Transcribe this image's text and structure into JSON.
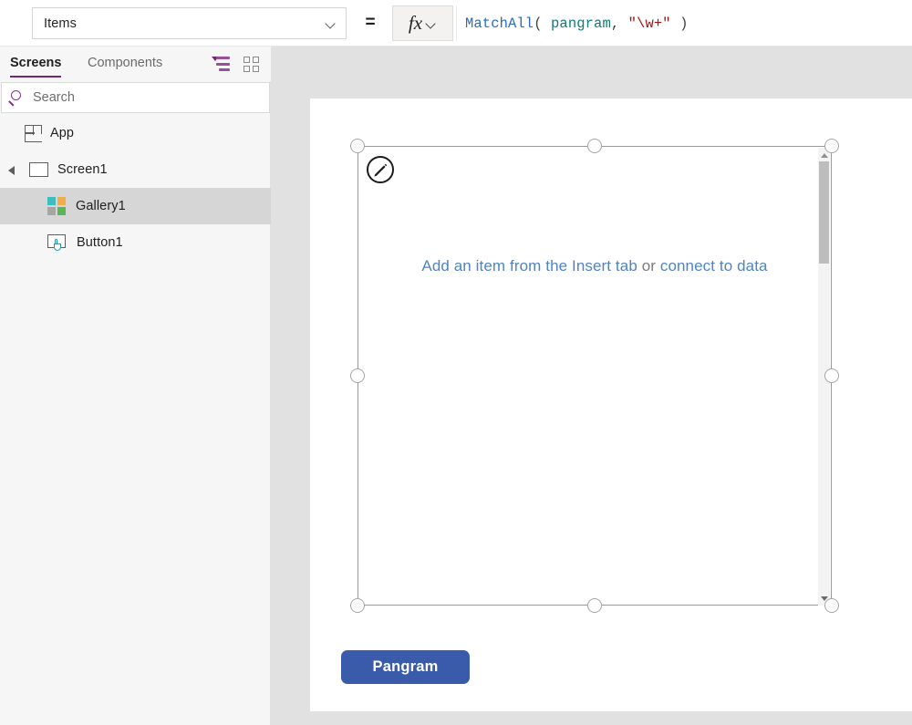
{
  "topbar": {
    "property_selector": {
      "name": "property-dropdown",
      "value": "Items",
      "chevron": "chevron-down-icon"
    },
    "equals_label": "=",
    "fx_button": {
      "label": "fx",
      "icon": "function-icon",
      "chevron": "chevron-down-icon"
    },
    "formula": {
      "full_text": "MatchAll( pangram, \"\\w+\" )",
      "tokens": [
        {
          "text": "MatchAll",
          "kind": "function",
          "color": "#2a6bbd"
        },
        {
          "text": "( ",
          "kind": "paren",
          "color": "#3f3f3f"
        },
        {
          "text": "pangram",
          "kind": "identifier",
          "color": "#0f7b7b"
        },
        {
          "text": ", ",
          "kind": "punct",
          "color": "#3f3f3f"
        },
        {
          "text": "\"\\w+\"",
          "kind": "string",
          "color": "#a31515"
        },
        {
          "text": " )",
          "kind": "paren",
          "color": "#3f3f3f"
        }
      ]
    }
  },
  "left_panel": {
    "tabs": [
      {
        "label": "Screens",
        "active": true
      },
      {
        "label": "Components",
        "active": false
      }
    ],
    "view_toggles": [
      {
        "icon": "tree-view-icon",
        "active": true,
        "color": "#742774"
      },
      {
        "icon": "grid-view-icon",
        "active": false,
        "color": "#8a8886"
      }
    ],
    "search": {
      "placeholder": "Search",
      "value": "",
      "icon": "search-icon"
    },
    "tree": [
      {
        "label": "App",
        "icon": "app-icon",
        "depth": 0,
        "selected": false,
        "expandable": false
      },
      {
        "label": "Screen1",
        "icon": "screen-icon",
        "depth": 0,
        "selected": false,
        "expandable": true,
        "expanded": true
      },
      {
        "label": "Gallery1",
        "icon": "gallery-icon",
        "depth": 1,
        "selected": true,
        "expandable": false
      },
      {
        "label": "Button1",
        "icon": "button-icon",
        "depth": 1,
        "selected": false,
        "expandable": false
      }
    ]
  },
  "canvas": {
    "background_color": "#e1e1e1",
    "screen_background": "#ffffff",
    "gallery": {
      "name": "Gallery1",
      "selected": true,
      "empty_state": {
        "link_1": "Add an item from the Insert tab",
        "separator": " or ",
        "link_2": "connect to data",
        "link_color": "#4e84c4",
        "text_color": "#7c7c7c"
      },
      "edit_button_icon": "pencil-icon",
      "scrollbar": {
        "up_arrow_icon": "chevron-up-icon",
        "down_arrow_icon": "chevron-down-icon",
        "thumb_position_percent": 3,
        "thumb_size_percent": 22
      },
      "selection_handles": 8
    },
    "controls": [
      {
        "name": "Button1",
        "label": "Pangram",
        "background_color": "#3a5ba9",
        "text_color": "#ffffff"
      }
    ]
  }
}
